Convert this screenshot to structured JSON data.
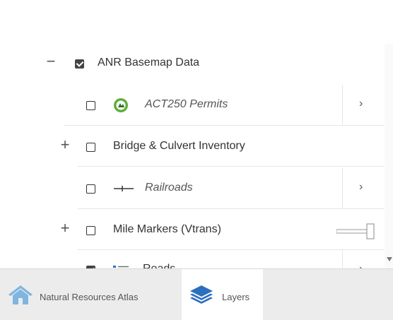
{
  "layers": {
    "items": [
      {
        "expander": "−",
        "label": "ANR Basemap Data",
        "checked": true
      },
      {
        "label": "ACT250 Permits",
        "checked": false,
        "icon": "act250-permit-icon",
        "chevron": "›"
      },
      {
        "expander": "+",
        "label": "Bridge & Culvert Inventory",
        "checked": false
      },
      {
        "label": "Railroads",
        "checked": false,
        "icon": "railroad-line-icon",
        "chevron": "›"
      },
      {
        "expander": "+",
        "label": "Mile Markers (Vtrans)",
        "checked": false
      },
      {
        "label": "Roads",
        "checked": true,
        "icon": "roads-legend-icon",
        "chevron": "›"
      }
    ],
    "opacity_slider": 1.0
  },
  "tabs": [
    {
      "label": "Natural Resources Atlas",
      "icon": "home-icon",
      "active": false
    },
    {
      "label": "Layers",
      "icon": "layers-icon",
      "active": true
    }
  ],
  "colors": {
    "act250_icon": "#5fae3b",
    "layers_icon": "#2c6fbf",
    "home_icon": "#7eb6e0"
  }
}
